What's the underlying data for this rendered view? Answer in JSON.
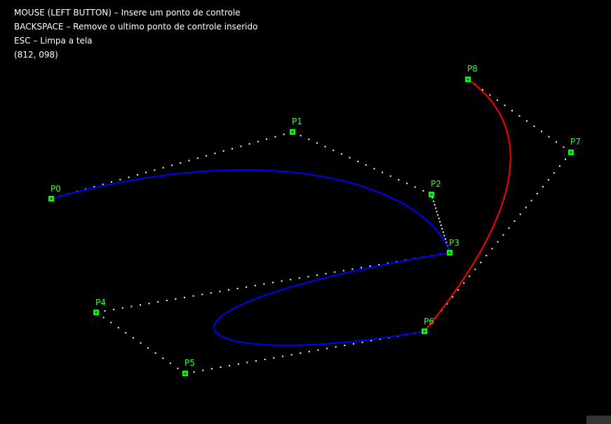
{
  "instructions": {
    "mouse": "MOUSE (LEFT BUTTON) – Insere um ponto de controle",
    "backspace": "BACKSPACE – Remove o ultimo ponto de controle inserido",
    "esc": "ESC – Limpa a tela",
    "coords": "(812, 098)"
  },
  "colors": {
    "background": "#000000",
    "text": "#ffffff",
    "point": "#00ff00",
    "point_inner": "#006600",
    "label": "#33ff33",
    "polygon_dots": "#ffffff",
    "curve_1": "#0000ff",
    "curve_2": "#ff0000"
  },
  "control_points": [
    {
      "label": "P0"
    },
    {
      "label": "P1"
    },
    {
      "label": "P2"
    },
    {
      "label": "P3"
    },
    {
      "label": "P4"
    },
    {
      "label": "P5"
    },
    {
      "label": "P6"
    },
    {
      "label": "P7"
    },
    {
      "label": "P8"
    }
  ]
}
